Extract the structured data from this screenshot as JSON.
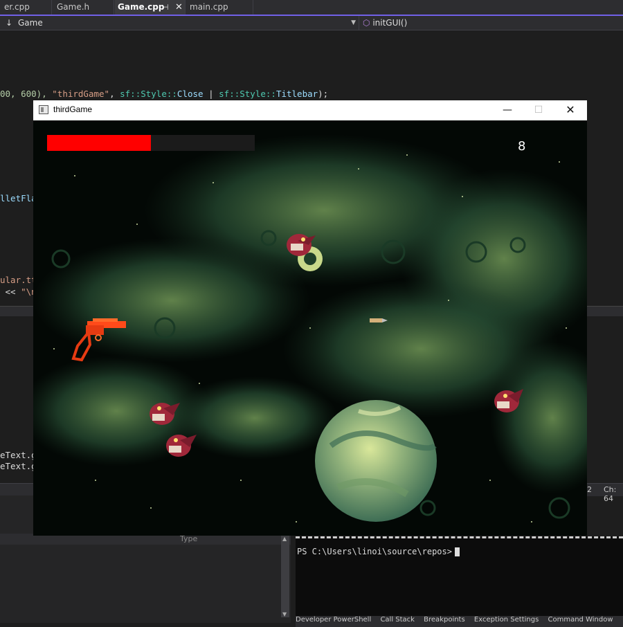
{
  "ide": {
    "tabs": [
      {
        "label": "er.cpp"
      },
      {
        "label": "Game.h"
      },
      {
        "label": "Game.cpp",
        "active": true
      },
      {
        "label": "main.cpp"
      }
    ],
    "pin_glyph": "⊣",
    "close_glyph": "✕",
    "nav_scope": "Game",
    "nav_member": "initGUI()",
    "code": {
      "l1_a": "00, 600), ",
      "l1_str": "\"thirdGame\"",
      "l1_b": ", ",
      "l1_ns1": "sf::Style::",
      "l1_c1": "Close",
      "l1_d": " | ",
      "l1_ns2": "sf::Style::",
      "l1_c2": "Titlebar",
      "l1_e": ");",
      "l2": "lletFla",
      "l3": "ular.tt",
      "l4_a": " << ",
      "l4_str": "\"\\n",
      "l5": "eText.g",
      "l6": "eText.g"
    },
    "status_ln": "2",
    "status_ch": "Ch: 64",
    "panel_column": "Type",
    "terminal_prompt": "PS C:\\Users\\linoi\\source\\repos>",
    "terminal_tabs": [
      "Developer PowerShell",
      "Call Stack",
      "Breakpoints",
      "Exception Settings",
      "Command Window"
    ]
  },
  "game_window": {
    "title": "thirdGame",
    "minimize_glyph": "—",
    "maximize_glyph": "☐",
    "close_glyph": "✕",
    "health_fraction": 0.5,
    "score": "8",
    "colors": {
      "health": "#ff0000",
      "health_track": "#1b1b1b",
      "space": "#030805",
      "nebula": "#2e5a3c"
    }
  }
}
